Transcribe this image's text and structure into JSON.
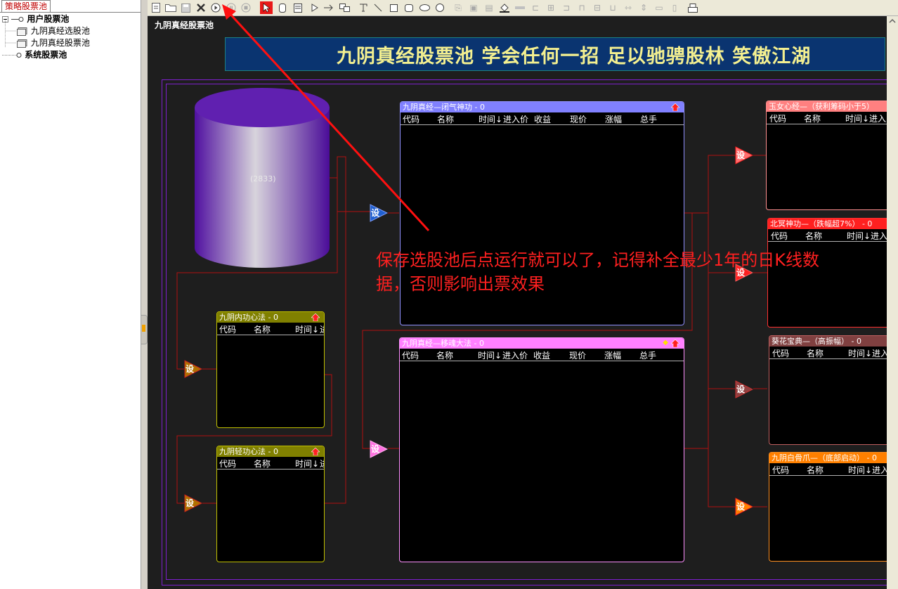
{
  "left_panel": {
    "tab_label": "策略股票池",
    "tree": {
      "user_pool_label": "用户股票池",
      "user_items": [
        "九阴真经选股池",
        "九阴真经股票池"
      ],
      "system_pool_label": "系统股票池"
    }
  },
  "toolbar": {
    "icons": [
      "new-file-icon",
      "open-folder-icon",
      "save-icon",
      "delete-icon",
      "run-icon",
      "pause-icon",
      "stop-icon",
      "pointer-icon",
      "rounded-rect-icon",
      "doc-block-icon",
      "play-shape-icon",
      "arrow-right-icon",
      "group-icon",
      "text-tool-icon",
      "line-icon",
      "rectangle-icon",
      "round-rect-icon",
      "ellipse-icon",
      "circle-icon",
      "copy-icon",
      "paste-icon",
      "clipboard-icon",
      "fill-color-icon",
      "line-style-icon",
      "align-left-icon",
      "align-center-icon",
      "align-right-icon",
      "align-top-icon",
      "align-middle-icon",
      "align-bottom-icon",
      "same-width-icon",
      "same-height-icon",
      "same-size-icon",
      "fit-height-icon",
      "print-icon"
    ]
  },
  "canvas": {
    "title": "九阴真经股票池",
    "banner": "九阴真经股票池 学会任何一招 足以驰骋股林 笑傲江湖",
    "source_count": "(2833)",
    "set_label": "设",
    "annotation_line1": "保存选股池后点运行就可以了，记得补全最少1年的日K线数",
    "annotation_line2": "据，否则影响出票效果"
  },
  "pools": {
    "bihe": {
      "title": "九阴真经—闭气神功 - 0",
      "columns": [
        "代码",
        "名称",
        "时间↓",
        "进入价",
        "收益",
        "现价",
        "涨幅",
        "总手"
      ]
    },
    "yihun": {
      "title": "九阴真经—移魂大法 - 0",
      "columns": [
        "代码",
        "名称",
        "时间↓",
        "进入价",
        "收益",
        "现价",
        "涨幅",
        "总手"
      ]
    },
    "neigong": {
      "title": "九阴内功心法 - 0",
      "columns": [
        "代码",
        "名称",
        "时间↓",
        "进"
      ]
    },
    "qinggong": {
      "title": "九阴轻功心法 - 0",
      "columns": [
        "代码",
        "名称",
        "时间↓",
        "进"
      ]
    },
    "yunv": {
      "title": "玉女心经—（获利筹码小于5）",
      "columns": [
        "代码",
        "名称",
        "时间↓",
        "进入"
      ]
    },
    "beiming": {
      "title": "北冥神功—（跌幅超7%） - 0",
      "columns": [
        "代码",
        "名称",
        "时间↓",
        "进入"
      ]
    },
    "kuihua": {
      "title": "葵花宝典—（高振幅） - 0",
      "columns": [
        "代码",
        "名称",
        "时间↓",
        "进入"
      ]
    },
    "baigu": {
      "title": "九阴白骨爪—（底部启动） - 0",
      "columns": [
        "代码",
        "名称",
        "时间↓",
        "进入"
      ]
    }
  },
  "colors": {
    "canvas_bg": "#1e1e1e",
    "banner_bg": "#0a3470",
    "banner_text": "#f4f090",
    "annotation": "#ff2020",
    "bihe_header": "#8080ff",
    "yihun_header": "#ff80ff",
    "neigong_header": "#808000",
    "yunv_header": "#ff8080",
    "beiming_header": "#ff2020",
    "kuihua_header": "#804040",
    "baigu_header": "#ff8000"
  }
}
